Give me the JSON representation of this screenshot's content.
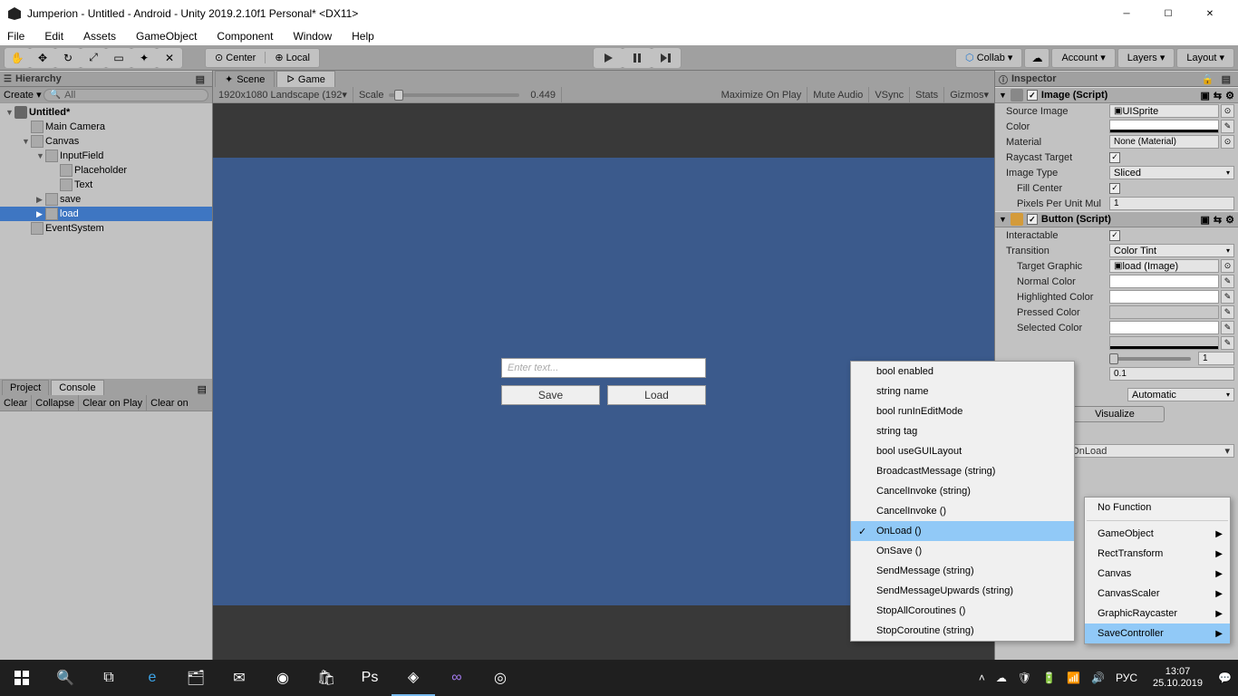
{
  "window": {
    "title": "Jumperion - Untitled - Android - Unity 2019.2.10f1 Personal* <DX11>"
  },
  "menu": [
    "File",
    "Edit",
    "Assets",
    "GameObject",
    "Component",
    "Window",
    "Help"
  ],
  "toolbar": {
    "center": "Center",
    "local": "Local",
    "collab": "Collab",
    "account": "Account",
    "layers": "Layers",
    "layout": "Layout"
  },
  "hierarchy": {
    "title": "Hierarchy",
    "create": "Create",
    "search_placeholder": "All",
    "scene": "Untitled*",
    "items": [
      "Main Camera",
      "Canvas",
      "InputField",
      "Placeholder",
      "Text",
      "save",
      "load",
      "EventSystem"
    ]
  },
  "project_tab": "Project",
  "console_tab": "Console",
  "console_buttons": [
    "Clear",
    "Collapse",
    "Clear on Play",
    "Clear on"
  ],
  "scene_tab": "Scene",
  "game_tab": "Game",
  "game_opts": {
    "aspect": "1920x1080 Landscape (192",
    "scale_label": "Scale",
    "scale_val": "0.449",
    "maxplay": "Maximize On Play",
    "mute": "Mute Audio",
    "vsync": "VSync",
    "stats": "Stats",
    "gizmos": "Gizmos"
  },
  "game_ui": {
    "placeholder": "Enter text...",
    "save": "Save",
    "load": "Load"
  },
  "inspector": {
    "title": "Inspector",
    "image": {
      "title": "Image (Script)",
      "source": "Source Image",
      "source_val": "UISprite",
      "color": "Color",
      "material": "Material",
      "material_val": "None (Material)",
      "raycast": "Raycast Target",
      "imgtype": "Image Type",
      "imgtype_val": "Sliced",
      "fill": "Fill Center",
      "ppu": "Pixels Per Unit Mul",
      "ppu_val": "1"
    },
    "button": {
      "title": "Button (Script)",
      "interactable": "Interactable",
      "transition": "Transition",
      "transition_val": "Color Tint",
      "target": "Target Graphic",
      "target_val": "load (Image)",
      "normal": "Normal Color",
      "highlighted": "Highlighted Color",
      "pressed": "Pressed Color",
      "selected": "Selected Color",
      "automatic": "Automatic",
      "visualize": "Visualize",
      "onclick_sel": "SaveController.OnLoad",
      "mult_val": "1",
      "fade_val": "0.1"
    }
  },
  "ctx_func": {
    "items": [
      "bool enabled",
      "string name",
      "bool runInEditMode",
      "string tag",
      "bool useGUILayout",
      "BroadcastMessage (string)",
      "CancelInvoke (string)",
      "CancelInvoke ()",
      "OnLoad ()",
      "OnSave ()",
      "SendMessage (string)",
      "SendMessageUpwards (string)",
      "StopAllCoroutines ()",
      "StopCoroutine (string)"
    ]
  },
  "ctx_comp": {
    "nofunc": "No Function",
    "items": [
      "GameObject",
      "RectTransform",
      "Canvas",
      "CanvasScaler",
      "GraphicRaycaster",
      "SaveController"
    ]
  },
  "taskbar": {
    "lang": "РУС",
    "time": "13:07",
    "date": "25.10.2019"
  }
}
